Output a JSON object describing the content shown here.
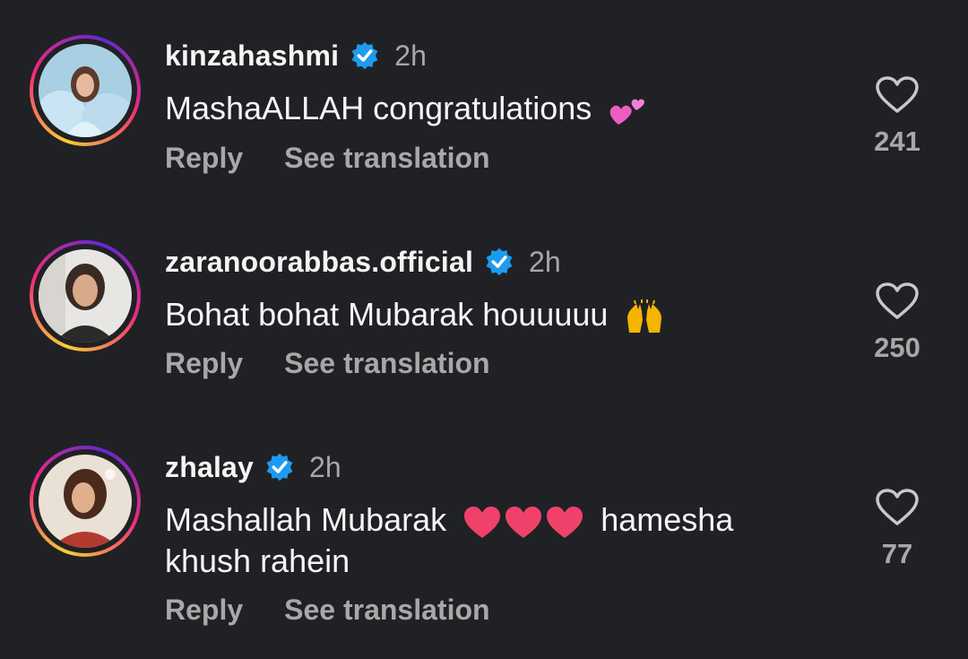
{
  "comments": [
    {
      "username": "kinzahashmi",
      "time": "2h",
      "text": "MashaALLAH congratulations",
      "emoji": "two-hearts-emoji",
      "reply_label": "Reply",
      "translate_label": "See translation",
      "likes": "241"
    },
    {
      "username": "zaranoorabbas.official",
      "time": "2h",
      "text": "Bohat bohat Mubarak houuuuu",
      "emoji": "raising-hands-emoji",
      "reply_label": "Reply",
      "translate_label": "See translation",
      "likes": "250"
    },
    {
      "username": "zhalay",
      "time": "2h",
      "text_before": "Mashallah Mubarak",
      "text_after": "hamesha",
      "text_line2": "khush rahein",
      "emoji": "red-hearts-emoji",
      "reply_label": "Reply",
      "translate_label": "See translation",
      "likes": "77"
    }
  ],
  "colors": {
    "background": "#202124",
    "text": "#f5f5f5",
    "secondary": "#a8a8a8",
    "verified": "#1d9bf0"
  },
  "icons": {
    "verified": "verified-badge-icon",
    "like": "heart-outline-icon"
  }
}
